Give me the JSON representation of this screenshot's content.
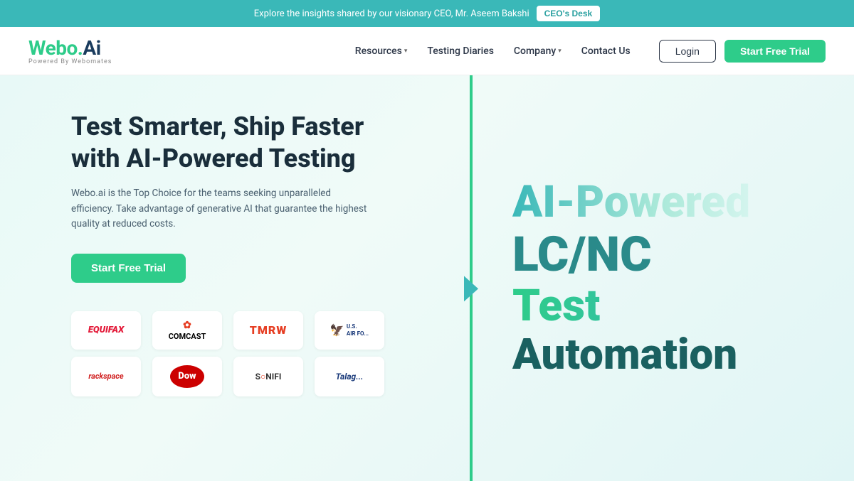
{
  "banner": {
    "text": "Explore the insights shared by our visionary CEO, Mr. Aseem Bakshi",
    "cta_label": "CEO's Desk"
  },
  "navbar": {
    "logo_main": "Webo.Ai",
    "logo_sub": "Powered By Webomates",
    "nav_items": [
      {
        "label": "Resources",
        "has_dropdown": true
      },
      {
        "label": "Testing Diaries",
        "has_dropdown": false
      },
      {
        "label": "Company",
        "has_dropdown": true
      },
      {
        "label": "Contact Us",
        "has_dropdown": false
      }
    ],
    "login_label": "Login",
    "trial_label": "Start Free Trial"
  },
  "hero": {
    "title": "Test Smarter, Ship Faster with AI-Powered Testing",
    "subtitle": "Webo.ai is the Top Choice for the teams seeking unparalleled efficiency. Take advantage of generative AI that guarantee the highest quality at reduced costs.",
    "cta_label": "Start Free Trial",
    "big_text_line1": "AI-Powered",
    "big_text_line2": "LC/NC",
    "big_text_line3": "Test",
    "big_text_line4": "Automation"
  },
  "logos": [
    {
      "name": "Equifax",
      "type": "equifax"
    },
    {
      "name": "Comcast",
      "type": "comcast"
    },
    {
      "name": "TMRW",
      "type": "tmrw"
    },
    {
      "name": "U.S. Air Force",
      "type": "usaf"
    },
    {
      "name": "Rackspace",
      "type": "rackspace"
    },
    {
      "name": "Dow",
      "type": "dow"
    },
    {
      "name": "SONIFI",
      "type": "sonifi"
    },
    {
      "name": "Talag",
      "type": "talag"
    }
  ],
  "colors": {
    "brand_green": "#2ecc8a",
    "brand_teal": "#3ab8b8",
    "dark_blue": "#1a2e3b",
    "banner_bg": "#3ab8b8"
  }
}
